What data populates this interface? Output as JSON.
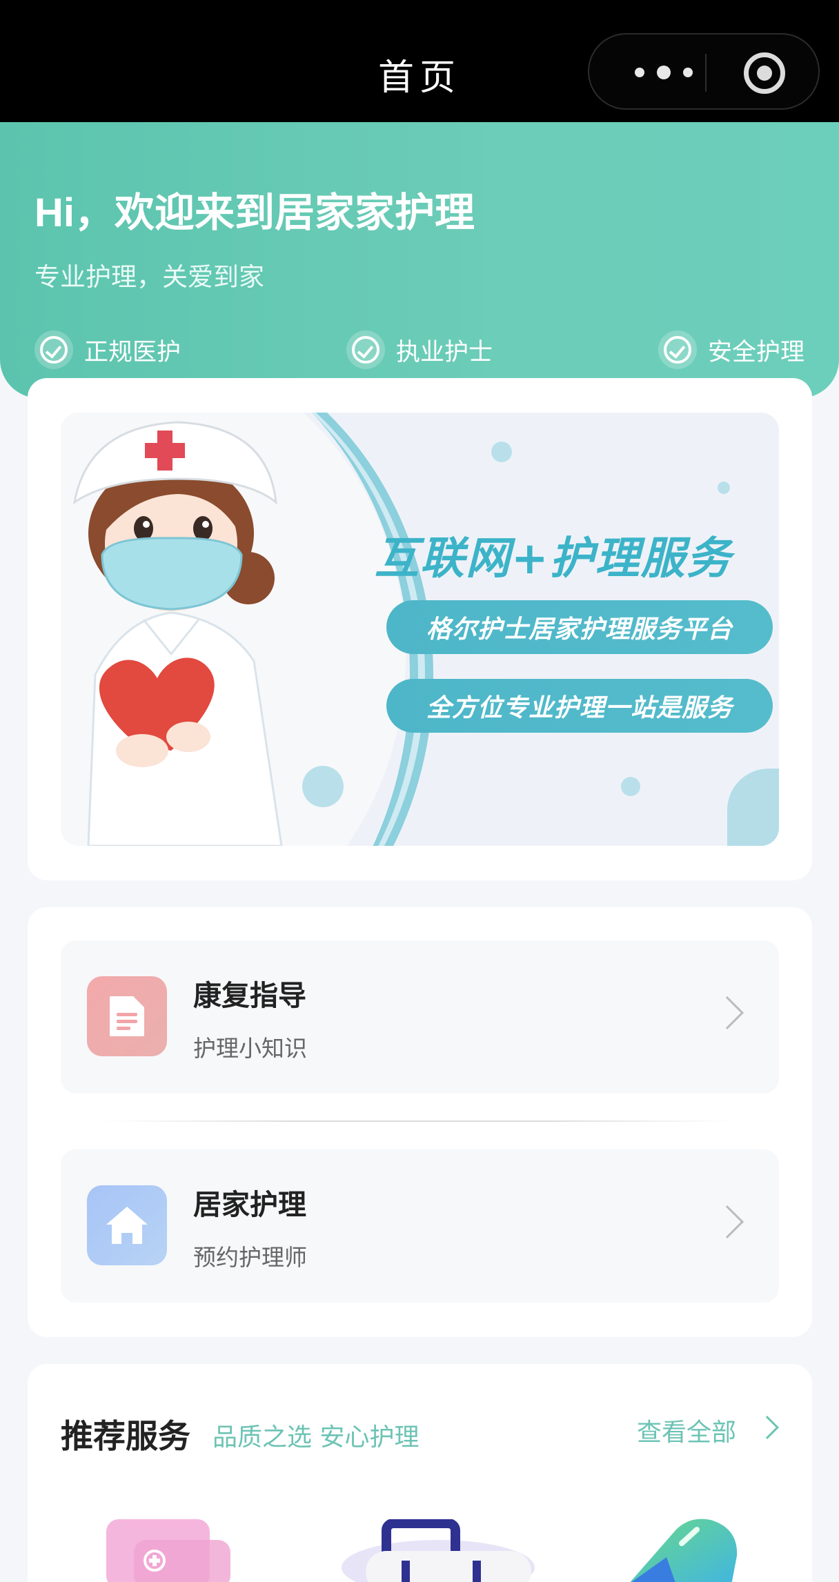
{
  "nav": {
    "title": "首页"
  },
  "hero": {
    "welcome": "Hi，欢迎来到居家家护理",
    "slogan": "专业护理，关爱到家",
    "badges": [
      {
        "label": "正规医护",
        "icon": "check-circle-icon"
      },
      {
        "label": "执业护士",
        "icon": "check-circle-icon"
      },
      {
        "label": "安全护理",
        "icon": "check-circle-icon"
      }
    ]
  },
  "banner": {
    "headline": "互联网+护理服务",
    "pill1": "格尔护士居家护理服务平台",
    "pill2": "全方位专业护理一站是服务"
  },
  "menu": [
    {
      "title": "康复指导",
      "subtitle": "护理小知识",
      "icon": "document-icon"
    },
    {
      "title": "居家护理",
      "subtitle": "预约护理师",
      "icon": "home-icon"
    }
  ],
  "recommend": {
    "title": "推荐服务",
    "subtitle": "品质之选 安心护理",
    "view_all": "查看全部"
  },
  "colors": {
    "primary": "#5cc4ae",
    "accent_text": "#6cc3b4",
    "banner_blue": "#4db6c8",
    "doc_icon_bg": "#f2a5a8",
    "home_icon_bg": "#a9c6f5"
  }
}
